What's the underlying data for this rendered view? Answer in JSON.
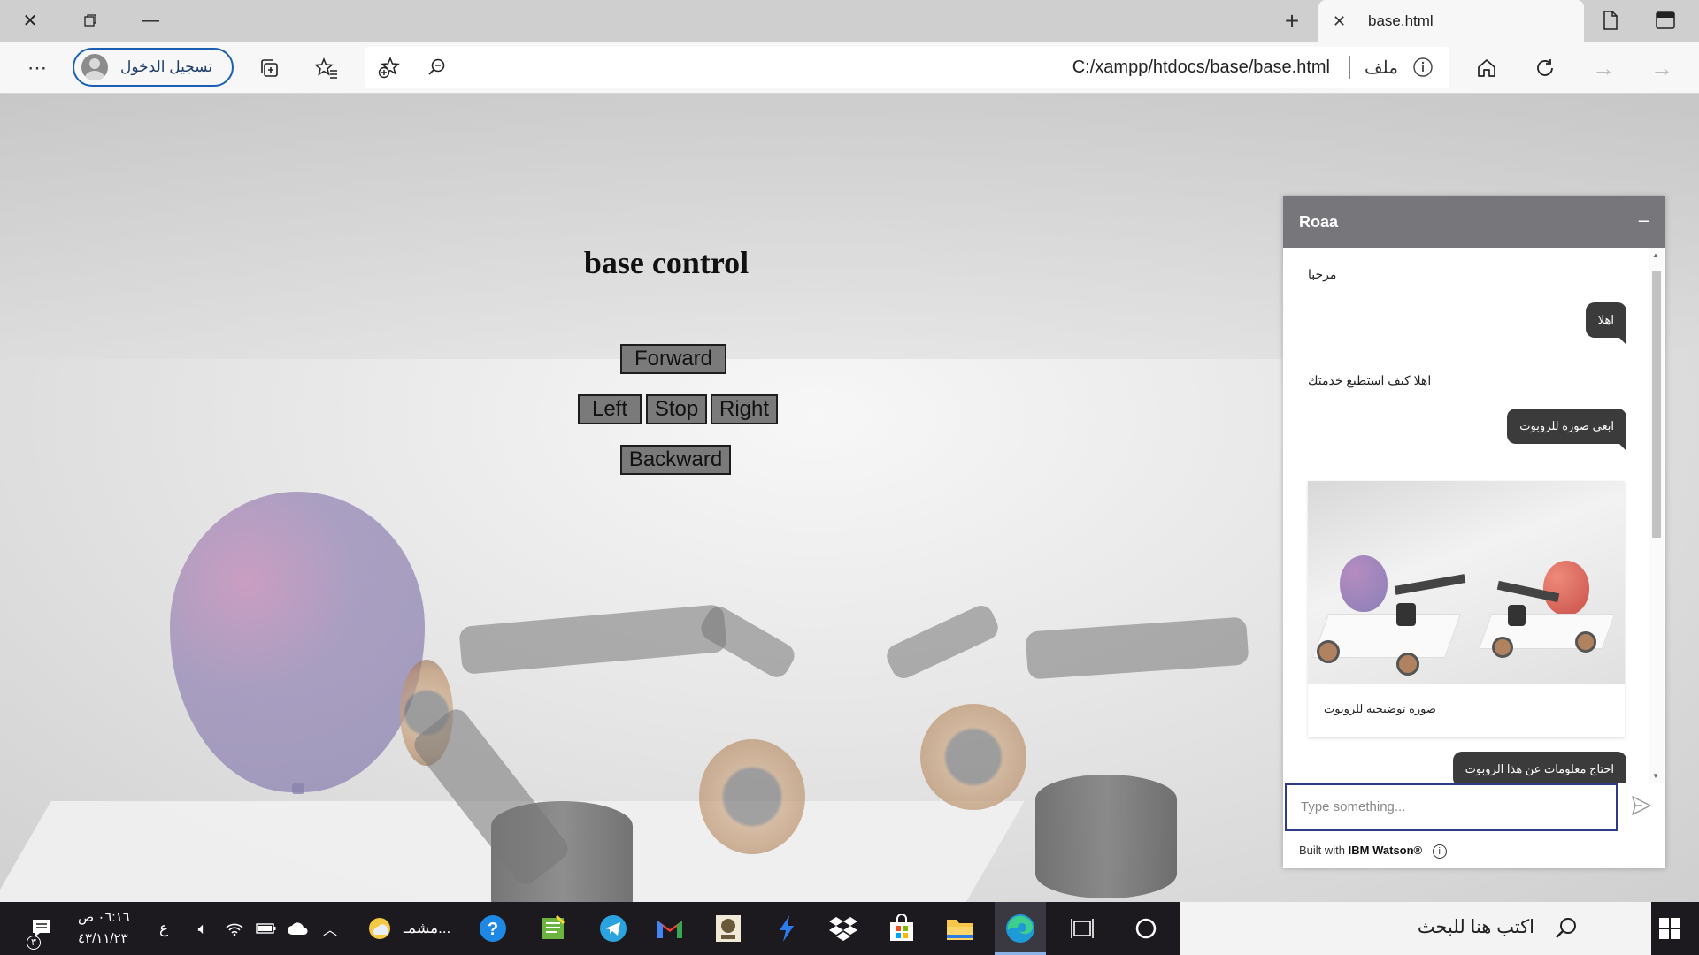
{
  "browser": {
    "tab_title": "base.html",
    "url": "C:/xampp/htdocs/base/base.html",
    "url_scheme_label": "ملف",
    "signin_label": "تسجيل الدخول"
  },
  "page": {
    "heading": "base control",
    "controls": {
      "forward": "Forward",
      "left": "Left",
      "stop": "Stop",
      "right": "Right",
      "backward": "Backward"
    }
  },
  "chat": {
    "title": "Roaa",
    "minimize": "–",
    "messages": [
      {
        "from": "bot",
        "text": "مرحبا"
      },
      {
        "from": "user",
        "text": "اهلا"
      },
      {
        "from": "bot",
        "text": "اهلا كيف استطيع خدمتك"
      },
      {
        "from": "user",
        "text": "ابغى صوره للروبوت"
      },
      {
        "from": "bot",
        "text": "صوره توضيحيه للروبوت"
      },
      {
        "from": "user",
        "text": "احتاج معلومات عن هذا الروبوت"
      }
    ],
    "help": "?",
    "input_placeholder": "Type something...",
    "built_with": "Built with",
    "built_brand": "IBM Watson®"
  },
  "taskbar": {
    "search_placeholder": "اكتب هنا للبحث",
    "weather_label": "مشمـ...",
    "time": "٠٦:١٦ ص",
    "date": "٤٣/١١/٢٣",
    "lang": "ع",
    "notif_count": "٣"
  }
}
